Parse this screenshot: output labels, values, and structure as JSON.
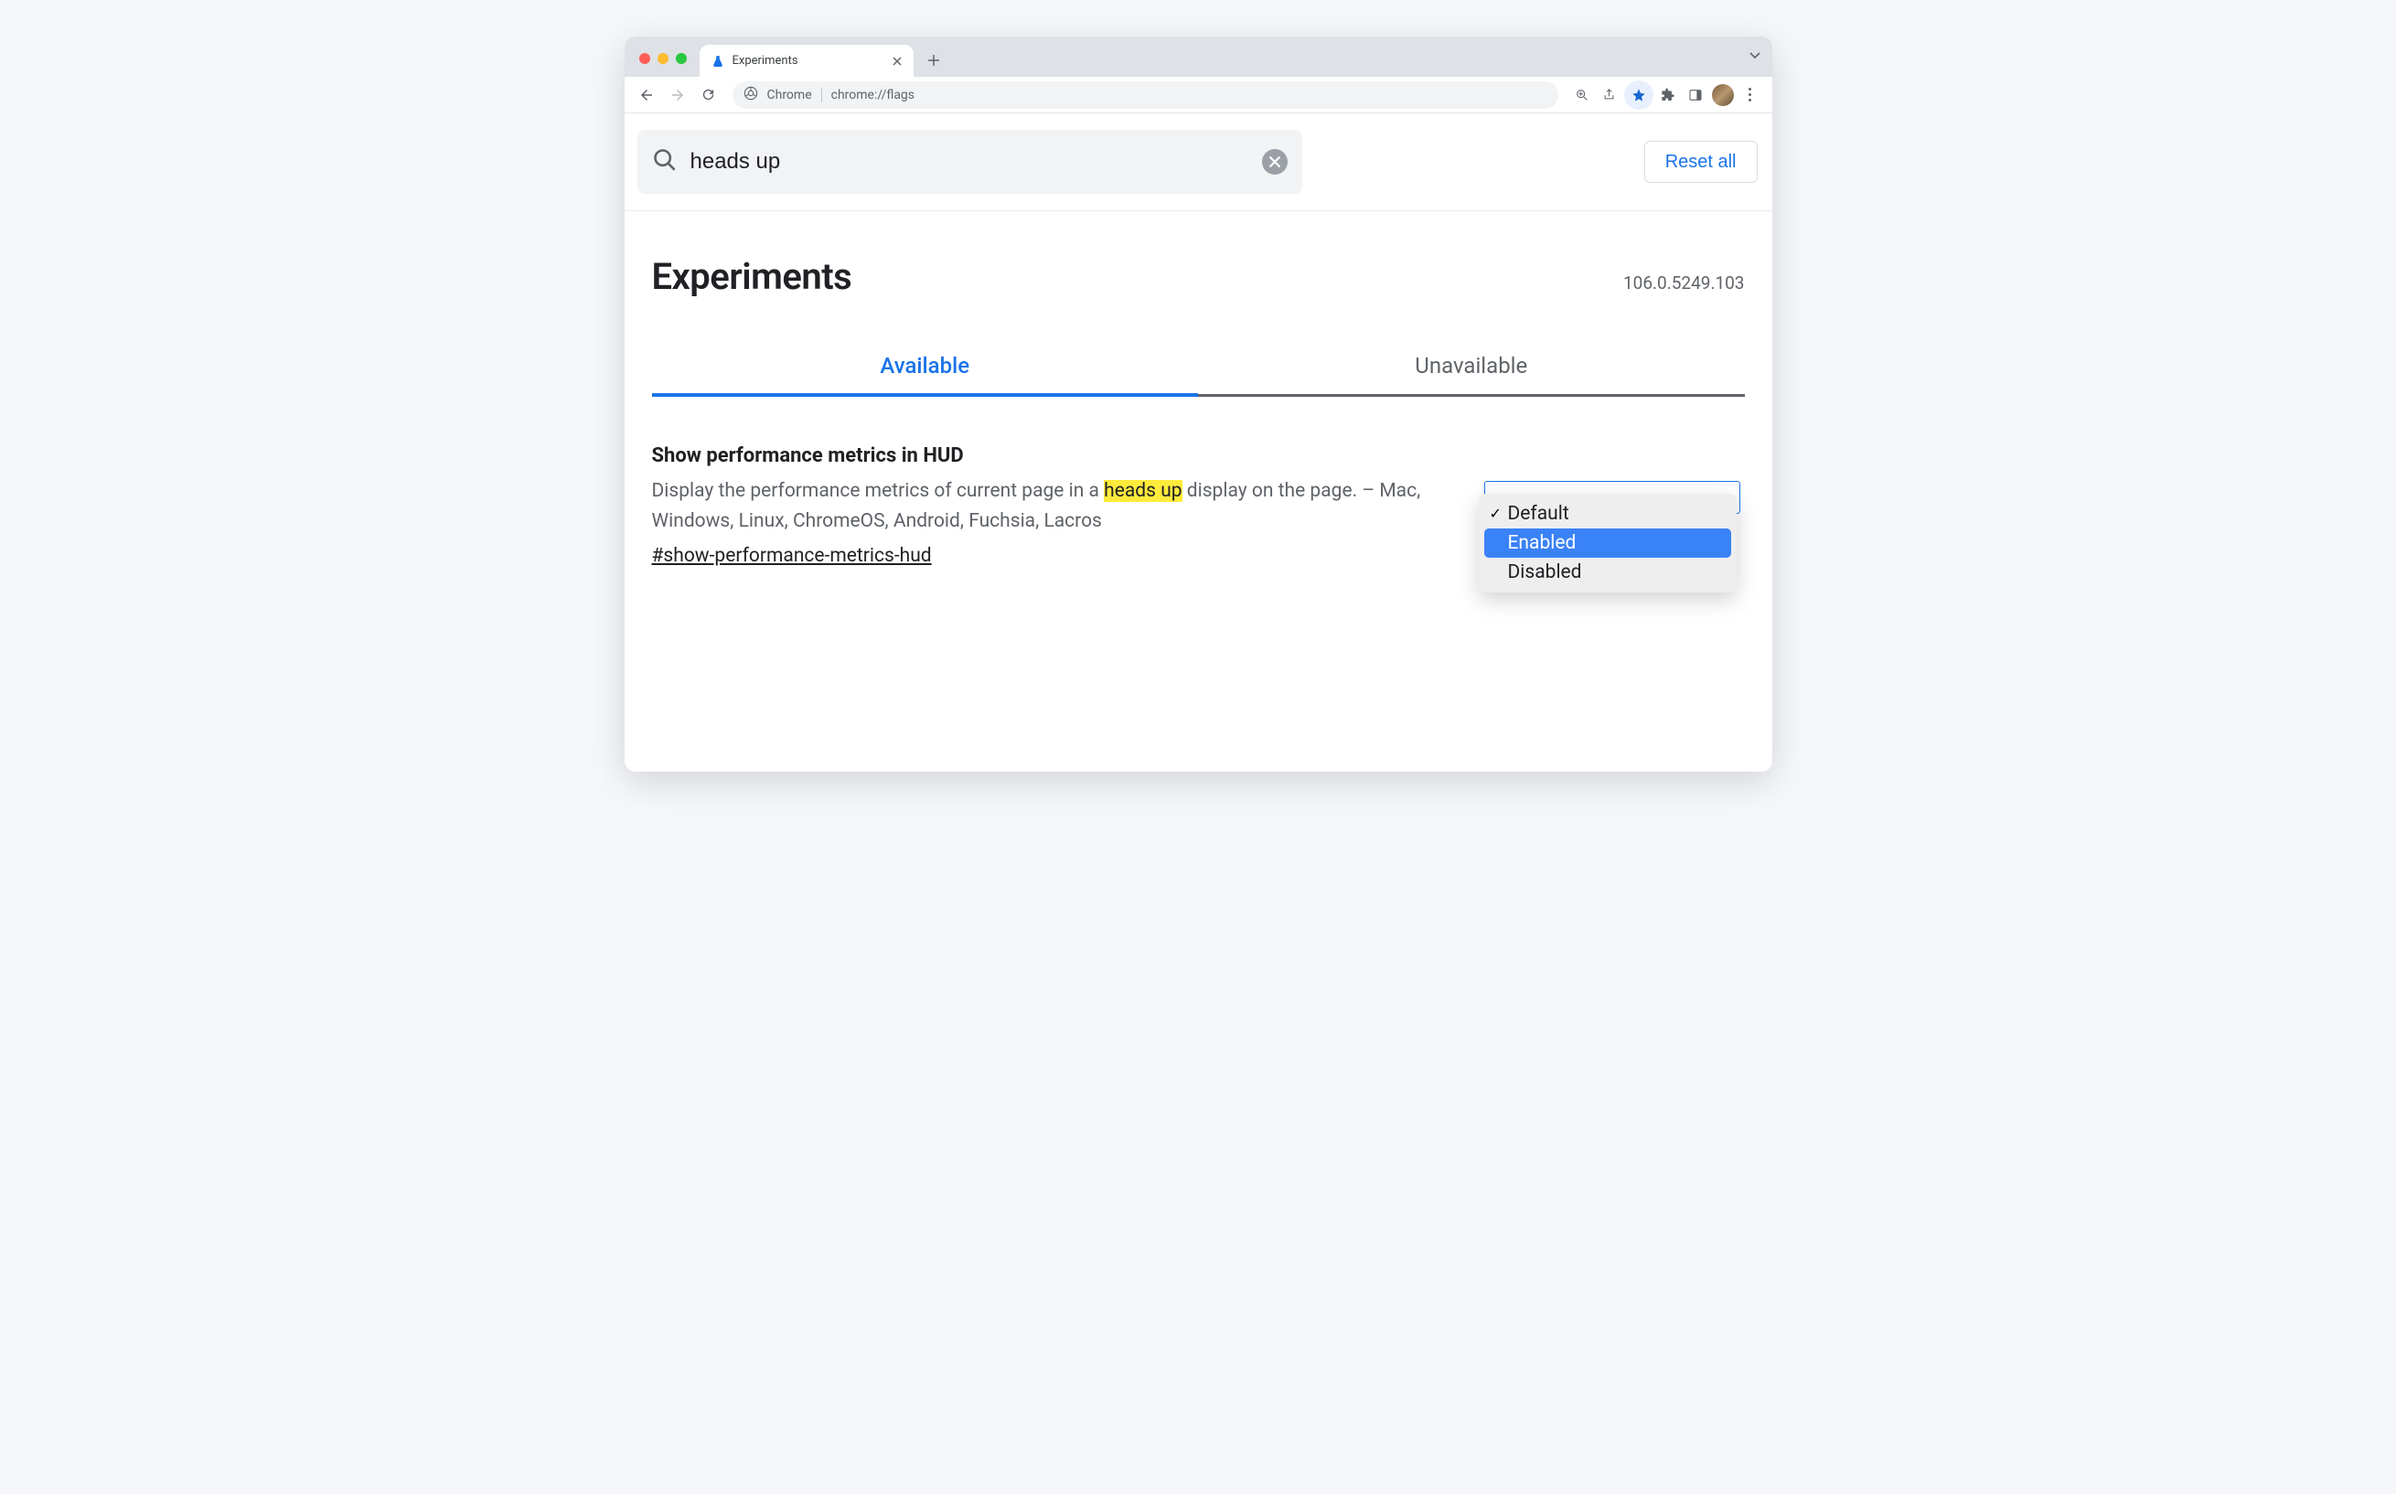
{
  "tab": {
    "title": "Experiments"
  },
  "omnibox": {
    "prefix": "Chrome",
    "url": "chrome://flags"
  },
  "search": {
    "value": "heads up"
  },
  "reset_label": "Reset all",
  "page_title": "Experiments",
  "version": "106.0.5249.103",
  "tabs": {
    "available": "Available",
    "unavailable": "Unavailable"
  },
  "flag": {
    "title": "Show performance metrics in HUD",
    "desc_before": "Display the performance metrics of current page in a ",
    "desc_highlight": "heads up",
    "desc_after": " display on the page. – Mac, Windows, Linux, ChromeOS, Android, Fuchsia, Lacros",
    "link": "#show-performance-metrics-hud"
  },
  "dropdown": {
    "options": {
      "default": "Default",
      "enabled": "Enabled",
      "disabled": "Disabled"
    }
  }
}
